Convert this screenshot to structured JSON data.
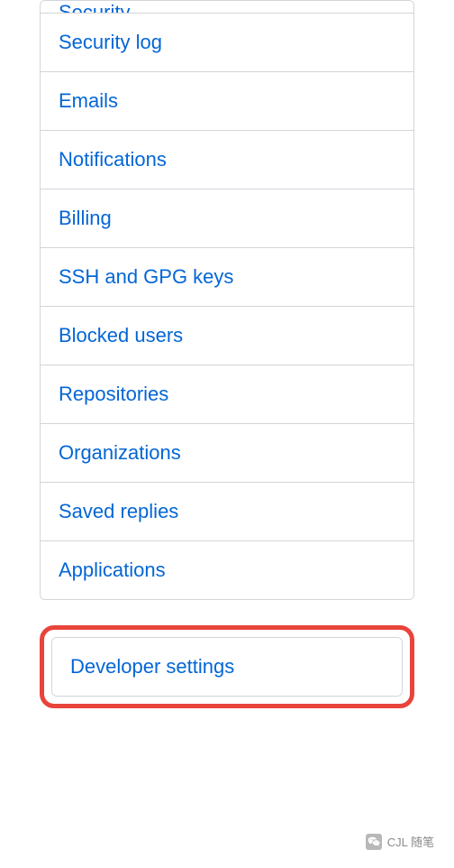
{
  "menu": {
    "partial_item": "Security",
    "items": [
      "Security log",
      "Emails",
      "Notifications",
      "Billing",
      "SSH and GPG keys",
      "Blocked users",
      "Repositories",
      "Organizations",
      "Saved replies",
      "Applications"
    ]
  },
  "highlighted": {
    "label": "Developer settings"
  },
  "watermark": {
    "text": "CJL 随笔"
  }
}
